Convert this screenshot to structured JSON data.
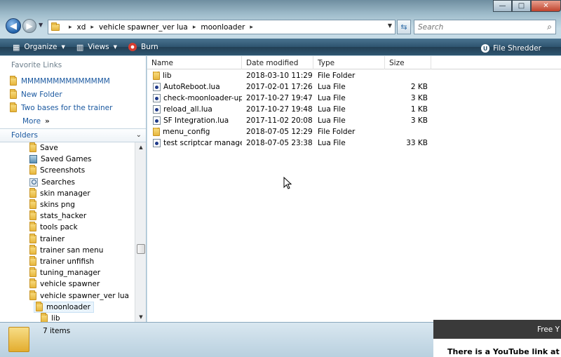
{
  "window": {
    "buttons": {
      "minimize": "—",
      "maximize": "□",
      "close": "✕"
    }
  },
  "address": {
    "crumbs": [
      "xd",
      "vehicle spawner_ver lua",
      "moonloader"
    ],
    "search_placeholder": "Search"
  },
  "toolbar": {
    "organize": "Organize",
    "views": "Views",
    "burn": "Burn",
    "file_shredder": "File Shredder"
  },
  "favorites": {
    "heading": "Favorite Links",
    "items": [
      "MMMMMMMMMMMMMM",
      "New Folder",
      "Two bases for the trainer"
    ],
    "more": "More"
  },
  "folders": {
    "heading": "Folders",
    "tree": [
      {
        "label": "Save",
        "icon": "folder"
      },
      {
        "label": "Saved Games",
        "icon": "saved-games"
      },
      {
        "label": "Screenshots",
        "icon": "folder"
      },
      {
        "label": "Searches",
        "icon": "searches"
      },
      {
        "label": "skin manager",
        "icon": "folder"
      },
      {
        "label": "skins png",
        "icon": "folder"
      },
      {
        "label": "stats_hacker",
        "icon": "folder"
      },
      {
        "label": "tools pack",
        "icon": "folder"
      },
      {
        "label": "trainer",
        "icon": "folder"
      },
      {
        "label": "trainer san menu",
        "icon": "folder"
      },
      {
        "label": "trainer unfifish",
        "icon": "folder"
      },
      {
        "label": "tuning_manager",
        "icon": "folder"
      },
      {
        "label": "vehicle spawner",
        "icon": "folder"
      },
      {
        "label": "vehicle spawner_ver lua",
        "icon": "folder"
      },
      {
        "label": "moonloader",
        "icon": "folder-open",
        "selected": true
      },
      {
        "label": "lib",
        "icon": "folder",
        "child": true
      }
    ]
  },
  "columns": {
    "name": "Name",
    "date": "Date modified",
    "type": "Type",
    "size": "Size"
  },
  "files": [
    {
      "name": "lib",
      "date": "2018-03-10 11:29",
      "type": "File Folder",
      "size": "",
      "icon": "folder"
    },
    {
      "name": "AutoReboot.lua",
      "date": "2017-02-01 17:26",
      "type": "Lua File",
      "size": "2 KB",
      "icon": "lua"
    },
    {
      "name": "check-moonloader-up...",
      "date": "2017-10-27 19:47",
      "type": "Lua File",
      "size": "3 KB",
      "icon": "lua"
    },
    {
      "name": "reload_all.lua",
      "date": "2017-10-27 19:48",
      "type": "Lua File",
      "size": "1 KB",
      "icon": "lua"
    },
    {
      "name": "SF Integration.lua",
      "date": "2017-11-02 20:08",
      "type": "Lua File",
      "size": "3 KB",
      "icon": "lua"
    },
    {
      "name": "menu_config",
      "date": "2018-07-05 12:29",
      "type": "File Folder",
      "size": "",
      "icon": "folder"
    },
    {
      "name": "test scriptcar manager...",
      "date": "2018-07-05 23:38",
      "type": "Lua File",
      "size": "33 KB",
      "icon": "lua"
    }
  ],
  "status": {
    "count": "7 items"
  },
  "popup": {
    "header": "Free Y",
    "body": "There is a YouTube link at th"
  }
}
